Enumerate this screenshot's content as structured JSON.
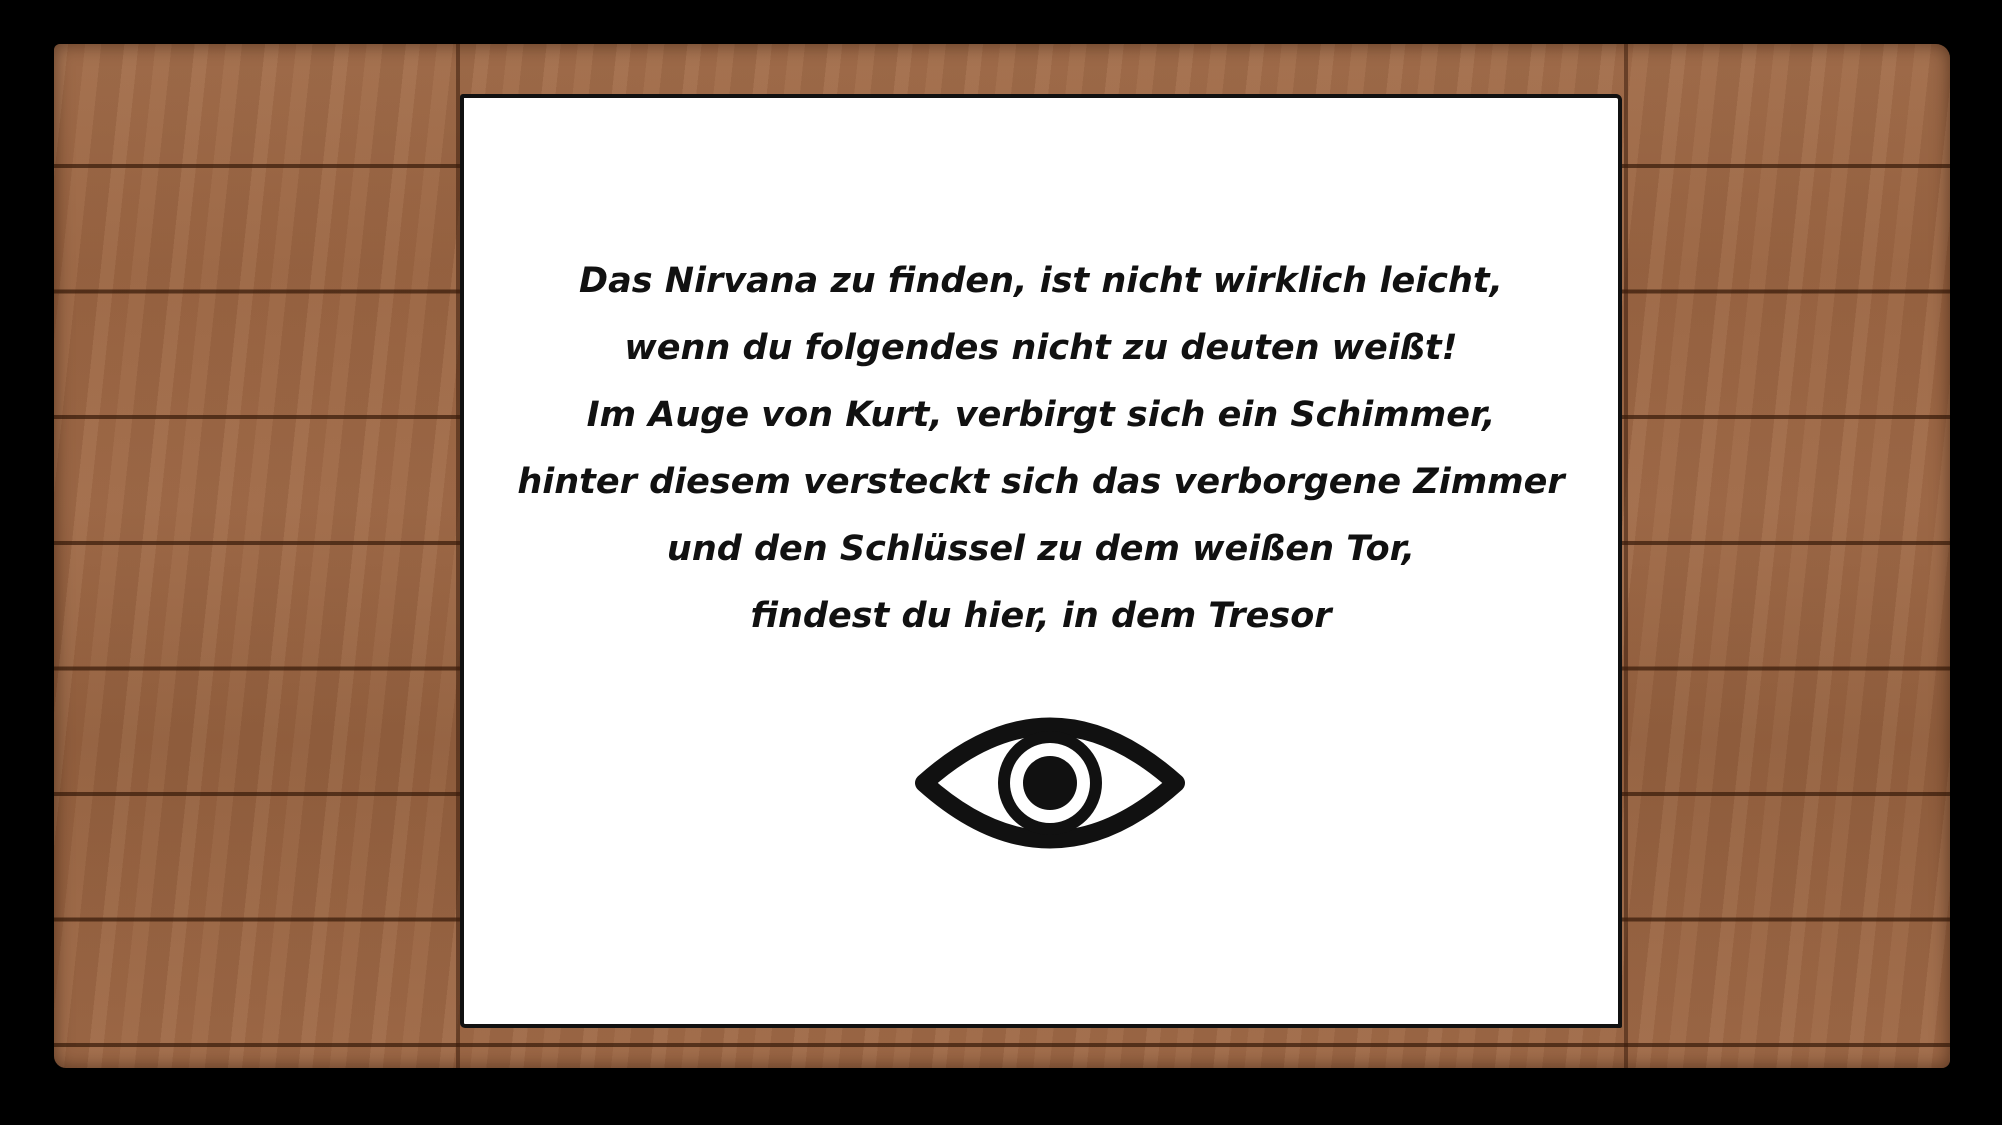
{
  "note": {
    "lines": [
      "Das Nirvana zu finden, ist nicht wirklich leicht,",
      "wenn du folgendes nicht zu deuten weißt!",
      "Im Auge von Kurt, verbirgt sich ein Schimmer,",
      "hinter diesem versteckt sich das verborgene Zimmer",
      "und den Schlüssel zu dem weißen Tor,",
      "findest du hier, in dem Tresor"
    ],
    "icon": "eye-icon"
  },
  "colors": {
    "background": "#000000",
    "wood": "#9a6543",
    "paper": "#ffffff",
    "ink": "#111111"
  }
}
